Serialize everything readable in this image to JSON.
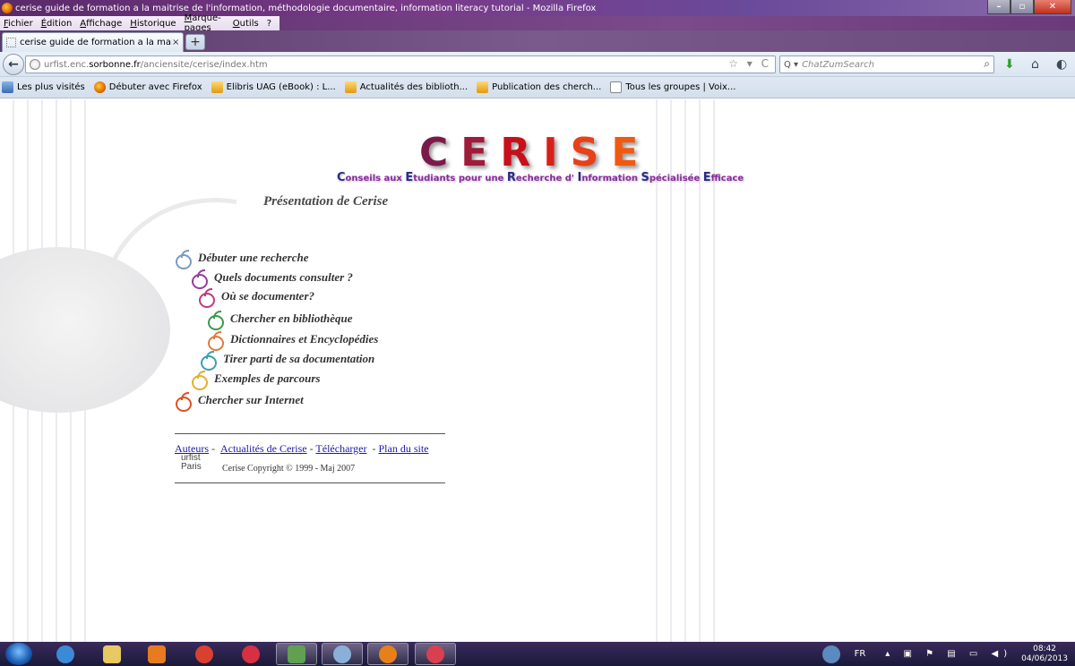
{
  "window": {
    "title": "cerise guide de formation a la maitrise de l'information, méthodologie documentaire, information literacy tutorial - Mozilla Firefox"
  },
  "menubar": {
    "items": [
      "Fichier",
      "Édition",
      "Affichage",
      "Historique",
      "Marque-pages",
      "Outils",
      "?"
    ]
  },
  "tabs": [
    {
      "label": "cerise guide de formation a la maitrise d...",
      "close": "×"
    }
  ],
  "newtab_label": "+",
  "navbar": {
    "back": "←",
    "url_prefix": "urfist.enc.",
    "url_domain": "sorbonne.fr",
    "url_path": "/anciensite/cerise/index.htm",
    "url_icons": "☆ ▾ C",
    "search_engine": "Q ▾",
    "search_placeholder": "ChatZumSearch",
    "search_go": "⌕",
    "download_icon": "⬇",
    "home_icon": "⌂",
    "addon_icon": "◐"
  },
  "bookmarks": [
    {
      "label": "Les plus visités",
      "icon": "blue"
    },
    {
      "label": "Débuter avec Firefox",
      "icon": "fox"
    },
    {
      "label": "Elibris UAG (eBook) : L...",
      "icon": "rss"
    },
    {
      "label": "Actualités des biblioth...",
      "icon": "rss"
    },
    {
      "label": "Publication des cherch...",
      "icon": "rss"
    },
    {
      "label": "Tous les groupes | Voix...",
      "icon": "page"
    }
  ],
  "page": {
    "logo_letters": [
      "C",
      "E",
      "R",
      "I",
      "S",
      "E"
    ],
    "tagline": [
      {
        "cap": "C",
        "rest": "onseils aux "
      },
      {
        "cap": "E",
        "rest": "tudiants pour une "
      },
      {
        "cap": "R",
        "rest": "echerche d' "
      },
      {
        "cap": "I",
        "rest": "nformation "
      },
      {
        "cap": "S",
        "rest": "pécialisée "
      },
      {
        "cap": "E",
        "rest": "fficace"
      }
    ],
    "heading": "Présentation de Cerise",
    "menu": [
      {
        "label": "Débuter une recherche",
        "color": "#7a9ac0"
      },
      {
        "label": "Quels documents consulter ?",
        "color": "#9a3aa0"
      },
      {
        "label": "Où se documenter?",
        "color": "#c03a7a"
      },
      {
        "label": "Chercher en bibliothèque",
        "color": "#3a9a4a"
      },
      {
        "label": "Dictionnaires et Encyclopédies",
        "color": "#e07a3a"
      },
      {
        "label": "Tirer parti de sa documentation",
        "color": "#3aa0b0"
      },
      {
        "label": "Exemples de parcours",
        "color": "#e0b030"
      },
      {
        "label": "Chercher sur Internet",
        "color": "#e05020"
      }
    ],
    "footer_links": [
      "Auteurs",
      "Actualités de Cerise",
      "Télécharger",
      "Plan du site"
    ],
    "urfist_line1": "urfist",
    "urfist_line2": "Paris",
    "copyright": "Cerise Copyright © 1999 - Maj 2007"
  },
  "taskbar": {
    "apps": [
      {
        "name": "internet-explorer",
        "color": "#3a8ad8"
      },
      {
        "name": "file-explorer",
        "color": "#e8c860"
      },
      {
        "name": "media-player",
        "color": "#e87a20"
      },
      {
        "name": "chrome",
        "color": "#d84030"
      },
      {
        "name": "app-red",
        "color": "#d83040"
      },
      {
        "name": "app-people",
        "color": "#60a050"
      },
      {
        "name": "app-mail",
        "color": "#8ab0d8"
      },
      {
        "name": "firefox",
        "color": "#e8801a"
      },
      {
        "name": "app-flower",
        "color": "#d84050"
      }
    ],
    "lang": "FR",
    "tray_icons": "▴ ▣ ⚑ ▤ ▭ ◀)",
    "time": "08:42",
    "date": "04/06/2013"
  }
}
